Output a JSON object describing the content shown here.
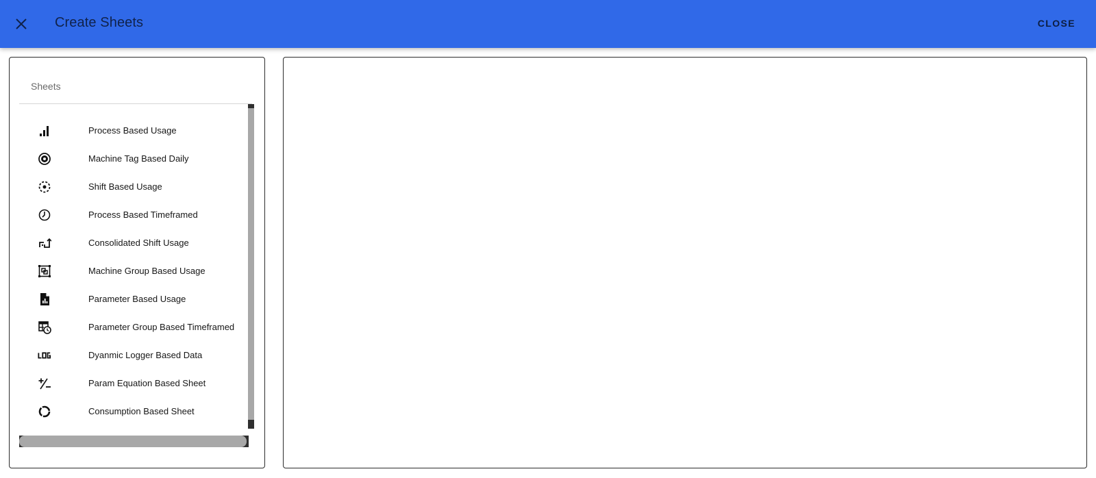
{
  "header": {
    "title": "Create Sheets",
    "close_label": "CLOSE",
    "bar_color": "#3069e8"
  },
  "sheets_panel": {
    "title": "Sheets",
    "items": [
      {
        "label": "Process Based Usage",
        "icon": "signal-bars-icon"
      },
      {
        "label": "Machine Tag Based Daily",
        "icon": "gear-circle-icon"
      },
      {
        "label": "Shift Based Usage",
        "icon": "dashed-circle-dot-icon"
      },
      {
        "label": "Process Based Timeframed",
        "icon": "clock-icon"
      },
      {
        "label": "Consolidated Shift Usage",
        "icon": "shift-arrows-icon"
      },
      {
        "label": "Machine Group Based Usage",
        "icon": "group-frame-icon"
      },
      {
        "label": "Parameter Based Usage",
        "icon": "document-chart-icon"
      },
      {
        "label": "Parameter Group Based Timeframed",
        "icon": "table-clock-icon"
      },
      {
        "label": "Dyanmic Logger Based Data",
        "icon": "log-text-icon"
      },
      {
        "label": "Param Equation Based Sheet",
        "icon": "plus-minus-icon"
      },
      {
        "label": "Consumption Based Sheet",
        "icon": "donut-ring-icon"
      }
    ]
  }
}
